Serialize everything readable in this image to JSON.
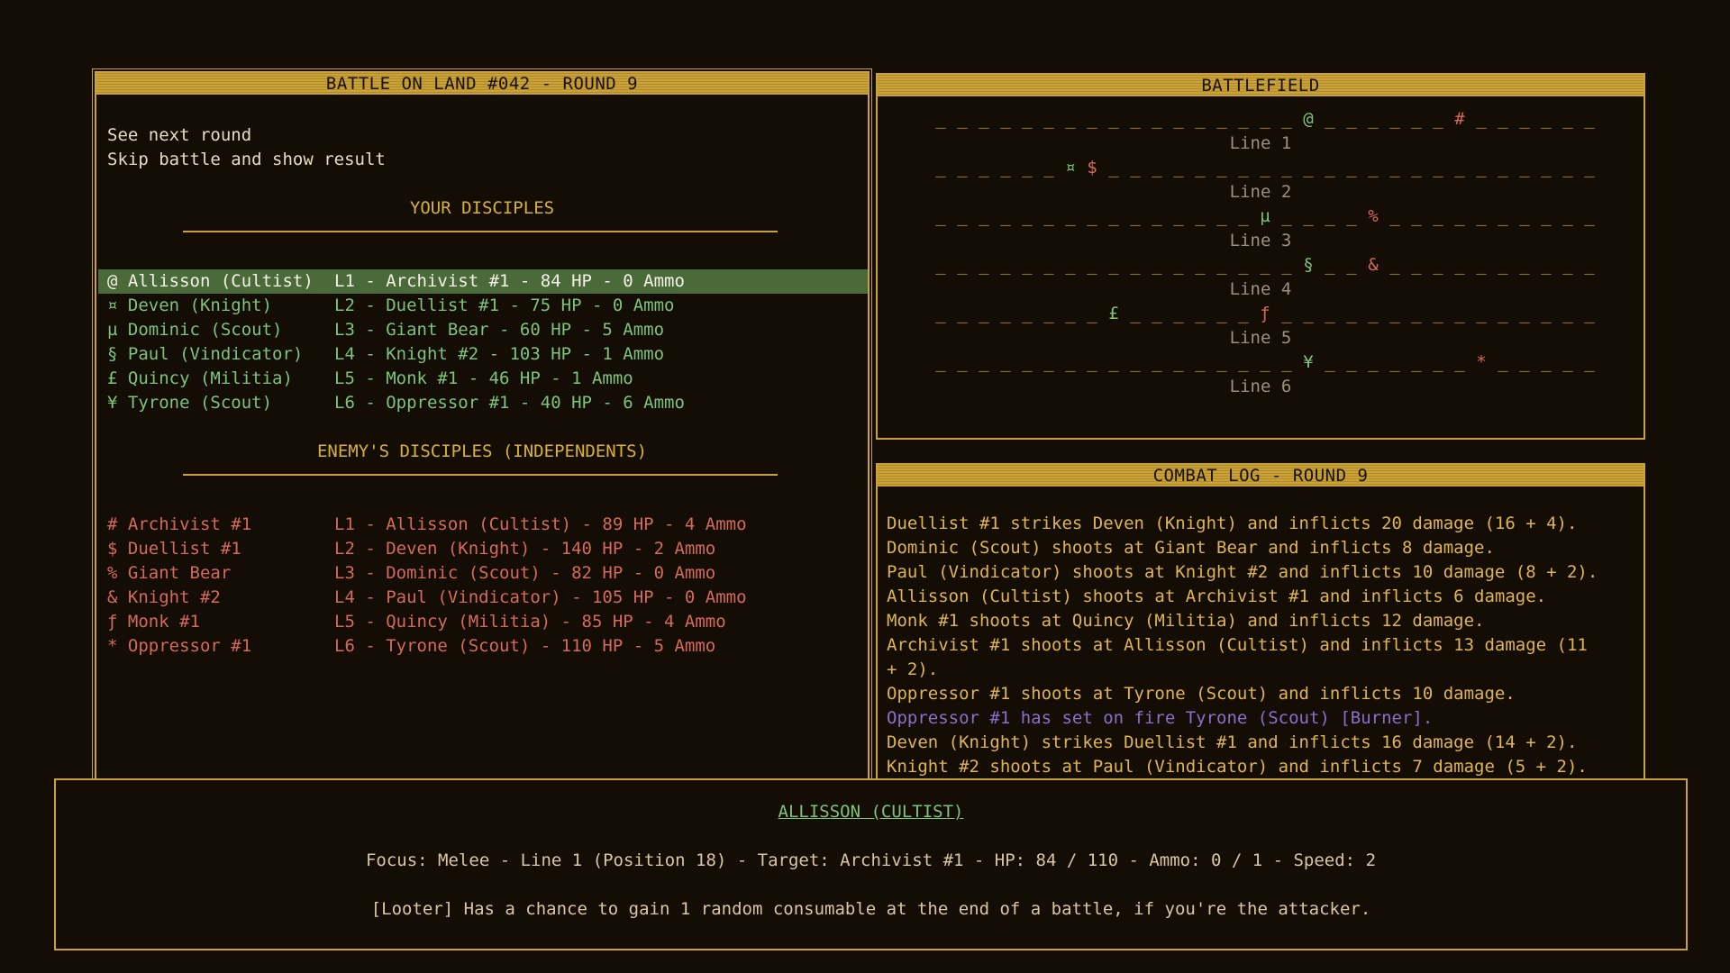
{
  "colors": {
    "background": "#140d05",
    "border": "#c9a23a",
    "ally": "#7fc27a",
    "enemy": "#d46a5a",
    "heading": "#d9b234",
    "log": "#dfb552",
    "effect": "#8b6fc9",
    "selected_row": "#4a6a3a"
  },
  "battle_panel": {
    "title": "BATTLE ON LAND #042 - ROUND 9",
    "menu": [
      "See next round",
      "Skip battle and show result"
    ],
    "your_heading": "YOUR DISCIPLES",
    "enemy_heading": "ENEMY'S DISCIPLES (INDEPENDENTS)",
    "allies": [
      {
        "name": "@ Allisson (Cultist)",
        "info": "L1 - Archivist #1 - 84 HP - 0 Ammo",
        "selected": true
      },
      {
        "name": "¤ Deven (Knight)",
        "info": "L2 - Duellist #1 - 75 HP - 0 Ammo",
        "selected": false
      },
      {
        "name": "µ Dominic (Scout)",
        "info": "L3 - Giant Bear - 60 HP - 5 Ammo",
        "selected": false
      },
      {
        "name": "§ Paul (Vindicator)",
        "info": "L4 - Knight #2 - 103 HP - 1 Ammo",
        "selected": false
      },
      {
        "name": "£ Quincy (Militia)",
        "info": "L5 - Monk #1 - 46 HP - 1 Ammo",
        "selected": false
      },
      {
        "name": "¥ Tyrone (Scout)",
        "info": "L6 - Oppressor #1 - 40 HP - 6 Ammo",
        "selected": false
      }
    ],
    "enemies": [
      {
        "name": "# Archivist #1",
        "info": "L1 - Allisson (Cultist) - 89 HP - 4 Ammo"
      },
      {
        "name": "$ Duellist #1",
        "info": "L2 - Deven (Knight) - 140 HP - 2 Ammo"
      },
      {
        "name": "% Giant Bear",
        "info": "L3 - Dominic (Scout) - 82 HP - 0 Ammo"
      },
      {
        "name": "& Knight #2",
        "info": "L4 - Paul (Vindicator) - 105 HP - 0 Ammo"
      },
      {
        "name": "ƒ Monk #1",
        "info": "L5 - Quincy (Militia) - 85 HP - 4 Ammo"
      },
      {
        "name": "* Oppressor #1",
        "info": "L6 - Tyrone (Scout) - 110 HP - 5 Ammo"
      }
    ]
  },
  "battlefield": {
    "title": "BATTLEFIELD",
    "positions": 31,
    "empty_symbol": "_",
    "lines": [
      {
        "label": "Line 1",
        "ally": {
          "symbol": "@",
          "pos": 18
        },
        "enemy": {
          "symbol": "#",
          "pos": 25
        }
      },
      {
        "label": "Line 2",
        "ally": {
          "symbol": "¤",
          "pos": 7
        },
        "enemy": {
          "symbol": "$",
          "pos": 8
        }
      },
      {
        "label": "Line 3",
        "ally": {
          "symbol": "µ",
          "pos": 16
        },
        "enemy": {
          "symbol": "%",
          "pos": 21
        }
      },
      {
        "label": "Line 4",
        "ally": {
          "symbol": "§",
          "pos": 18
        },
        "enemy": {
          "symbol": "&",
          "pos": 21
        }
      },
      {
        "label": "Line 5",
        "ally": {
          "symbol": "£",
          "pos": 9
        },
        "enemy": {
          "symbol": "ƒ",
          "pos": 16
        }
      },
      {
        "label": "Line 6",
        "ally": {
          "symbol": "¥",
          "pos": 18
        },
        "enemy": {
          "symbol": "*",
          "pos": 26
        }
      }
    ]
  },
  "combat_log": {
    "title": "COMBAT LOG - ROUND 9",
    "entries": [
      {
        "text": "Duellist #1 strikes Deven (Knight) and inflicts 20 damage (16 + 4).",
        "effect": false
      },
      {
        "text": "Dominic (Scout) shoots at Giant Bear and inflicts 8 damage.",
        "effect": false
      },
      {
        "text": "Paul (Vindicator) shoots at Knight #2 and inflicts 10 damage (8 + 2).",
        "effect": false
      },
      {
        "text": "Allisson (Cultist) shoots at Archivist #1 and inflicts 6 damage.",
        "effect": false
      },
      {
        "text": "Monk #1 shoots at Quincy (Militia) and inflicts 12 damage.",
        "effect": false
      },
      {
        "text": "Archivist #1 shoots at Allisson (Cultist) and inflicts 13 damage (11",
        "effect": false
      },
      {
        "text": "+ 2).",
        "effect": false
      },
      {
        "text": "Oppressor #1 shoots at Tyrone (Scout) and inflicts 10 damage.",
        "effect": false
      },
      {
        "text": "Oppressor #1 has set on fire Tyrone (Scout) [Burner].",
        "effect": true
      },
      {
        "text": "Deven (Knight) strikes Duellist #1 and inflicts 16 damage (14 + 2).",
        "effect": false
      },
      {
        "text": "Knight #2 shoots at Paul (Vindicator) and inflicts 7 damage (5 + 2).",
        "effect": false
      }
    ]
  },
  "details": {
    "name": "ALLISSON (CULTIST)",
    "stats": "Focus: Melee - Line 1 (Position 18) - Target: Archivist #1 - HP: 84 / 110 - Ammo: 0 / 1 - Speed: 2",
    "trait": "[Looter] Has a chance to gain 1 random consumable at the end of a battle, if you're the attacker."
  }
}
